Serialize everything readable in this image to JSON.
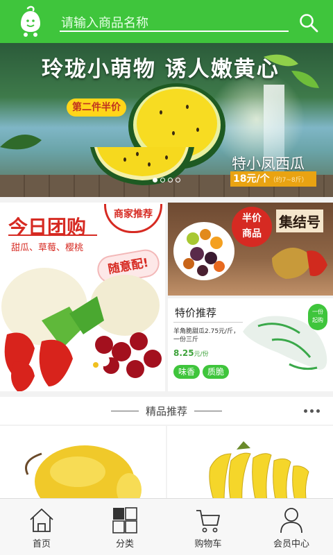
{
  "header": {
    "search_placeholder": "请输入商品名称"
  },
  "banner": {
    "title": "玲珑小萌物 诱人嫩黄心",
    "tag": "第二件半价",
    "product_name": "特小凤西瓜",
    "price": "18元/个",
    "price_note": "（约7~8斤）",
    "slides": 4,
    "active_slide": 1
  },
  "promos": {
    "group_buy": {
      "title": "今日团购",
      "subtitle": "甜瓜、草莓、樱桃",
      "merchant_badge": "商家推荐",
      "slogan": "随意配!"
    },
    "collection": {
      "tag_line1": "半价",
      "tag_line2": "商品",
      "title": "集结号"
    },
    "special": {
      "title": "特价推荐",
      "description": "羊角脆甜瓜2.75元/斤，一份三斤",
      "price": "8.25",
      "unit": "元/份",
      "features": [
        "味香",
        "质脆"
      ],
      "badge_line1": "一份",
      "badge_line2": "起购"
    }
  },
  "section": {
    "title": "精品推荐"
  },
  "tabbar": {
    "items": [
      {
        "label": "首页",
        "icon": "home-icon"
      },
      {
        "label": "分类",
        "icon": "grid-icon"
      },
      {
        "label": "购物车",
        "icon": "cart-icon"
      },
      {
        "label": "会员中心",
        "icon": "user-icon"
      }
    ]
  },
  "colors": {
    "brand": "#3fc53c",
    "accent_red": "#d62a22",
    "price_orange": "#e9a312"
  }
}
